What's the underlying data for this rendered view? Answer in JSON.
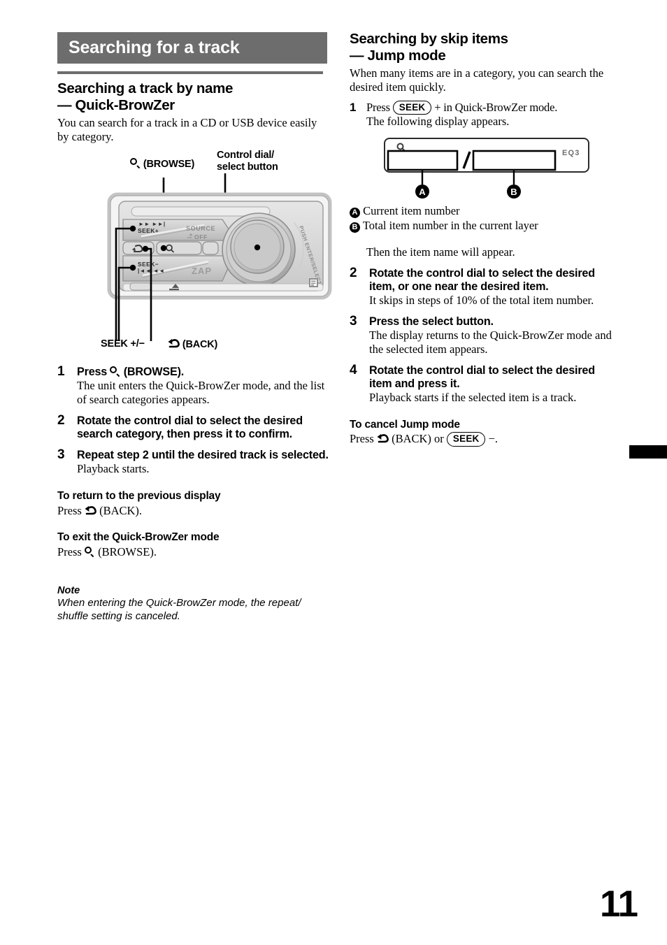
{
  "page": {
    "number": "11",
    "edge_tab": true
  },
  "section": {
    "bar_title": "Searching for a track"
  },
  "left_column": {
    "heading_line1": "Searching a track by name",
    "heading_line2": "— Quick-BrowZer",
    "intro": "You can search for a track in a CD or USB device easily by category.",
    "figure": {
      "label_browse": "(BROWSE)",
      "label_control_dial_line1": "Control dial/",
      "label_control_dial_line2": "select button",
      "label_seek": "SEEK +/−",
      "label_back": "(BACK)",
      "unit_text_source": "SOURCE",
      "unit_text_off": "OFF",
      "unit_text_zap": "ZAP",
      "unit_text_seek_plus": "SEEK+",
      "unit_text_seek_minus": "SEEK−",
      "unit_text_dial_ring": "PUSH ENTER/SELECT",
      "icons": {
        "browse": "search-icon",
        "back": "back-arrow-icon"
      }
    },
    "steps": [
      {
        "num": "1",
        "title_prefix": "Press",
        "title_icon": "search-icon",
        "title_suffix": "(BROWSE).",
        "body": "The unit enters the Quick-BrowZer mode, and the list of search categories appears."
      },
      {
        "num": "2",
        "title": "Rotate the control dial to select the desired search category, then press it to confirm.",
        "body": ""
      },
      {
        "num": "3",
        "title": "Repeat step 2 until the desired track is selected.",
        "body": "Playback starts."
      }
    ],
    "minor_sections": [
      {
        "heading": "To return to the previous display",
        "text_prefix": "Press",
        "icon": "back-arrow-icon",
        "text_suffix": "(BACK)."
      },
      {
        "heading": "To exit the Quick-BrowZer mode",
        "text_prefix": "Press",
        "icon": "search-icon",
        "text_suffix": "(BROWSE)."
      }
    ],
    "note": {
      "label": "Note",
      "text": "When entering the Quick-BrowZer mode, the repeat/ shuffle setting is canceled."
    }
  },
  "right_column": {
    "heading_line1": "Searching by skip items",
    "heading_line2": "— Jump mode",
    "intro": "When many items are in a category, you can search the desired item quickly.",
    "step1": {
      "num": "1",
      "text_prefix": "Press",
      "button_label": "SEEK",
      "text_suffix": "+ in Quick-BrowZer mode.",
      "body": "The following display appears."
    },
    "lcd": {
      "search_icon": "search-icon",
      "separator": "/",
      "indicator": "EQ3",
      "callout_a": "A",
      "callout_b": "B"
    },
    "legend": [
      {
        "marker": "A",
        "text": "Current item number"
      },
      {
        "marker": "B",
        "text": "Total item number in the current layer"
      }
    ],
    "after_legend": "Then the item name will appear.",
    "steps": [
      {
        "num": "2",
        "title": "Rotate the control dial to select the desired item, or one near the desired item.",
        "body": "It skips in steps of 10% of the total item number."
      },
      {
        "num": "3",
        "title": "Press the select button.",
        "body": "The display returns to the Quick-BrowZer mode and the selected item appears."
      },
      {
        "num": "4",
        "title": "Rotate the control dial to select the desired item and press it.",
        "body": "Playback starts if the selected item is a track."
      }
    ],
    "cancel_section": {
      "heading": "To cancel Jump mode",
      "text_prefix": "Press",
      "back_icon": "back-arrow-icon",
      "text_mid": "(BACK) or",
      "button_label": "SEEK",
      "text_suffix": "−."
    }
  },
  "colors": {
    "section_bar": "#6d6d6d",
    "rule": "#6d6d6d",
    "text": "#000000",
    "device_body": "#d9d9d9"
  }
}
